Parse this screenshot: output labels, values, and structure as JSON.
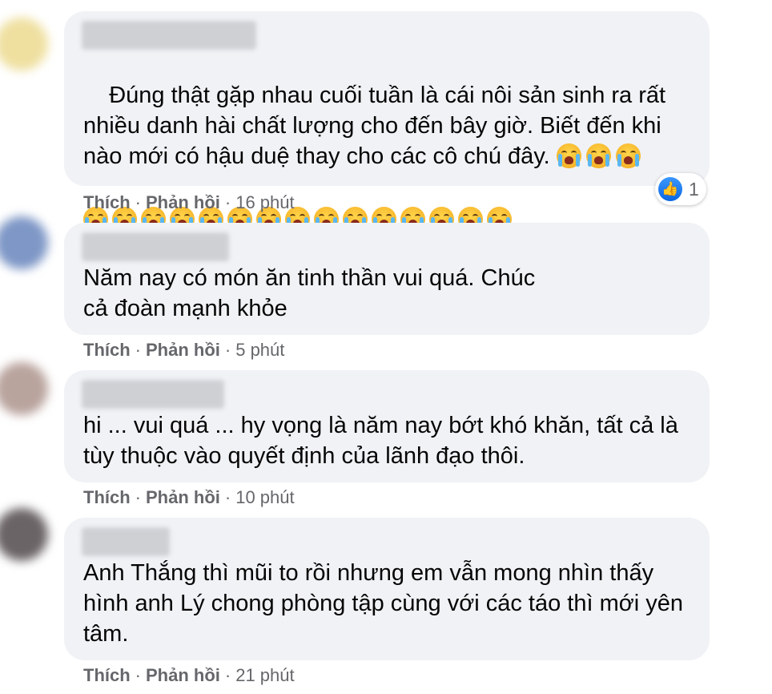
{
  "comments": [
    {
      "text": "Đúng thật gặp nhau cuối tuần là cái nôi sản sinh ra rất nhiều danh hài chất lượng cho đến bây giờ. Biết đến khi nào mới có hậu duệ thay cho các cô chú đây.",
      "emoji_name": "crying-face-emoji",
      "inline_emoji_count": 3,
      "row_emoji_count": 15,
      "like": "Thích",
      "reply": "Phản hồi",
      "time": "16 phút",
      "reaction_icon": "like-icon",
      "reaction_count": "1"
    },
    {
      "text": "Năm nay có món ăn tinh thần vui quá. Chúc cả đoàn mạnh khỏe",
      "like": "Thích",
      "reply": "Phản hồi",
      "time": "5 phút"
    },
    {
      "text": "hi ... vui quá ... hy vọng là năm nay bớt khó khăn, tất cả là tùy thuộc vào quyết định của lãnh đạo thôi.",
      "like": "Thích",
      "reply": "Phản hồi",
      "time": "10 phút"
    },
    {
      "text": "Anh Thắng thì mũi to rồi nhưng em vẫn mong nhìn thấy hình anh Lý chong phòng tập cùng với các táo thì mới yên tâm.",
      "like": "Thích",
      "reply": "Phản hồi",
      "time": "21 phút"
    }
  ],
  "separator": "·",
  "colors": {
    "bubble": "#f0f2f5",
    "meta_text": "#65676b",
    "like_blue": "#1877f2"
  }
}
